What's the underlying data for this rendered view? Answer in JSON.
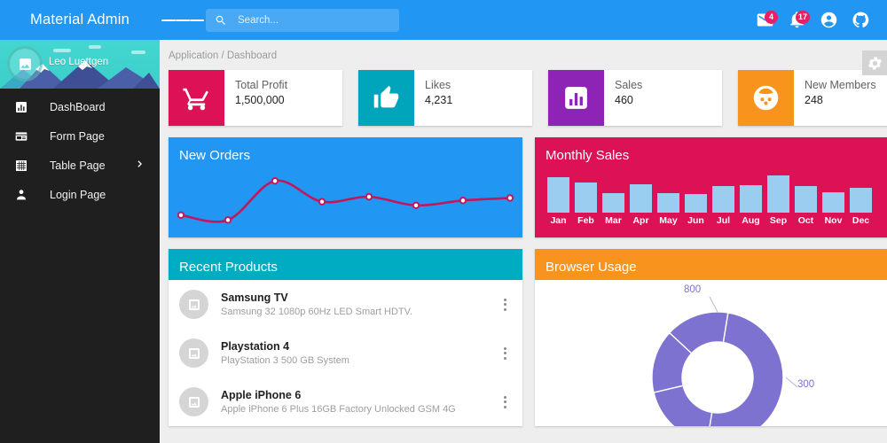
{
  "brand": {
    "title": "Material Admin"
  },
  "profile": {
    "name": "Leo Luettgen",
    "avatar_icon": "image-icon"
  },
  "sidebar": {
    "items": [
      {
        "label": "DashBoard",
        "icon": "bar-chart-icon",
        "has_chevron": false
      },
      {
        "label": "Form Page",
        "icon": "form-icon",
        "has_chevron": false
      },
      {
        "label": "Table Page",
        "icon": "grid-icon",
        "has_chevron": true
      },
      {
        "label": "Login Page",
        "icon": "person-icon",
        "has_chevron": false
      }
    ]
  },
  "topbar": {
    "menu_icon": "hamburger-icon",
    "search": {
      "placeholder": "Search...",
      "value": "",
      "icon": "search-icon"
    },
    "actions": [
      {
        "name": "mail-icon",
        "badge": "4"
      },
      {
        "name": "bell-icon",
        "badge": "17"
      },
      {
        "name": "account-circle-icon",
        "badge": ""
      },
      {
        "name": "github-icon",
        "badge": ""
      }
    ]
  },
  "content": {
    "breadcrumb": "Application / Dashboard",
    "settings_icon": "gear-icon"
  },
  "stats": [
    {
      "label": "Total Profit",
      "value": "1,500,000",
      "icon": "cart-icon",
      "color": "#dd1155"
    },
    {
      "label": "Likes",
      "value": "4,231",
      "icon": "thumb-up-icon",
      "color": "#00a5bb"
    },
    {
      "label": "Sales",
      "value": "460",
      "icon": "bar-chart-icon",
      "color": "#8e24b5"
    },
    {
      "label": "New Members",
      "value": "248",
      "icon": "face-icon",
      "color": "#f8941d"
    }
  ],
  "panels": {
    "new_orders": {
      "title": "New Orders",
      "bg": "#2196f3"
    },
    "monthly_sales": {
      "title": "Monthly Sales",
      "bg": "#dd1155"
    },
    "recent_products": {
      "title": "Recent Products",
      "bg": "#00acc1"
    },
    "browser_usage": {
      "title": "Browser Usage",
      "bg": "#f8941d"
    }
  },
  "products": [
    {
      "name": "Samsung TV",
      "desc": "Samsung 32 1080p 60Hz LED Smart HDTV.",
      "thumb": "image-icon",
      "menu": "more-vert-icon"
    },
    {
      "name": "Playstation 4",
      "desc": "PlayStation 3 500 GB System",
      "thumb": "image-icon",
      "menu": "more-vert-icon"
    },
    {
      "name": "Apple iPhone 6",
      "desc": "Apple iPhone 6 Plus 16GB Factory Unlocked GSM 4G",
      "thumb": "image-icon",
      "menu": "more-vert-icon"
    }
  ],
  "chart_data": [
    {
      "type": "line",
      "title": "New Orders",
      "x": [
        1,
        2,
        3,
        4,
        5,
        6,
        7,
        8
      ],
      "values": [
        22,
        14,
        78,
        44,
        52,
        38,
        46,
        50
      ],
      "series": [
        {
          "name": "New Orders",
          "values": [
            22,
            14,
            78,
            44,
            52,
            38,
            46,
            50
          ]
        }
      ],
      "xlabel": "",
      "ylabel": "",
      "ylim": [
        0,
        100
      ],
      "line_color": "#c2185b",
      "point_color": "#ffffff",
      "grid": false,
      "legend": "none"
    },
    {
      "type": "bar",
      "title": "Monthly Sales",
      "categories": [
        "Jan",
        "Feb",
        "Mar",
        "Apr",
        "May",
        "Jun",
        "Jul",
        "Aug",
        "Sep",
        "Oct",
        "Nov",
        "Dec"
      ],
      "values": [
        44,
        38,
        25,
        36,
        25,
        23,
        33,
        35,
        47,
        33,
        26,
        31
      ],
      "xlabel": "",
      "ylabel": "",
      "ylim": [
        0,
        50
      ],
      "bar_color": "#9bcdf0",
      "grid": false,
      "legend": "none"
    },
    {
      "type": "pie",
      "title": "Browser Usage",
      "labels": [
        "800",
        "300",
        "",
        ""
      ],
      "values": [
        800,
        300,
        250,
        250
      ],
      "annotations": [
        "800",
        "300"
      ],
      "colors": [
        "#7d72d0",
        "#7d72d0",
        "#7d72d0",
        "#7d72d0"
      ],
      "legend": "none",
      "donut": true
    }
  ]
}
